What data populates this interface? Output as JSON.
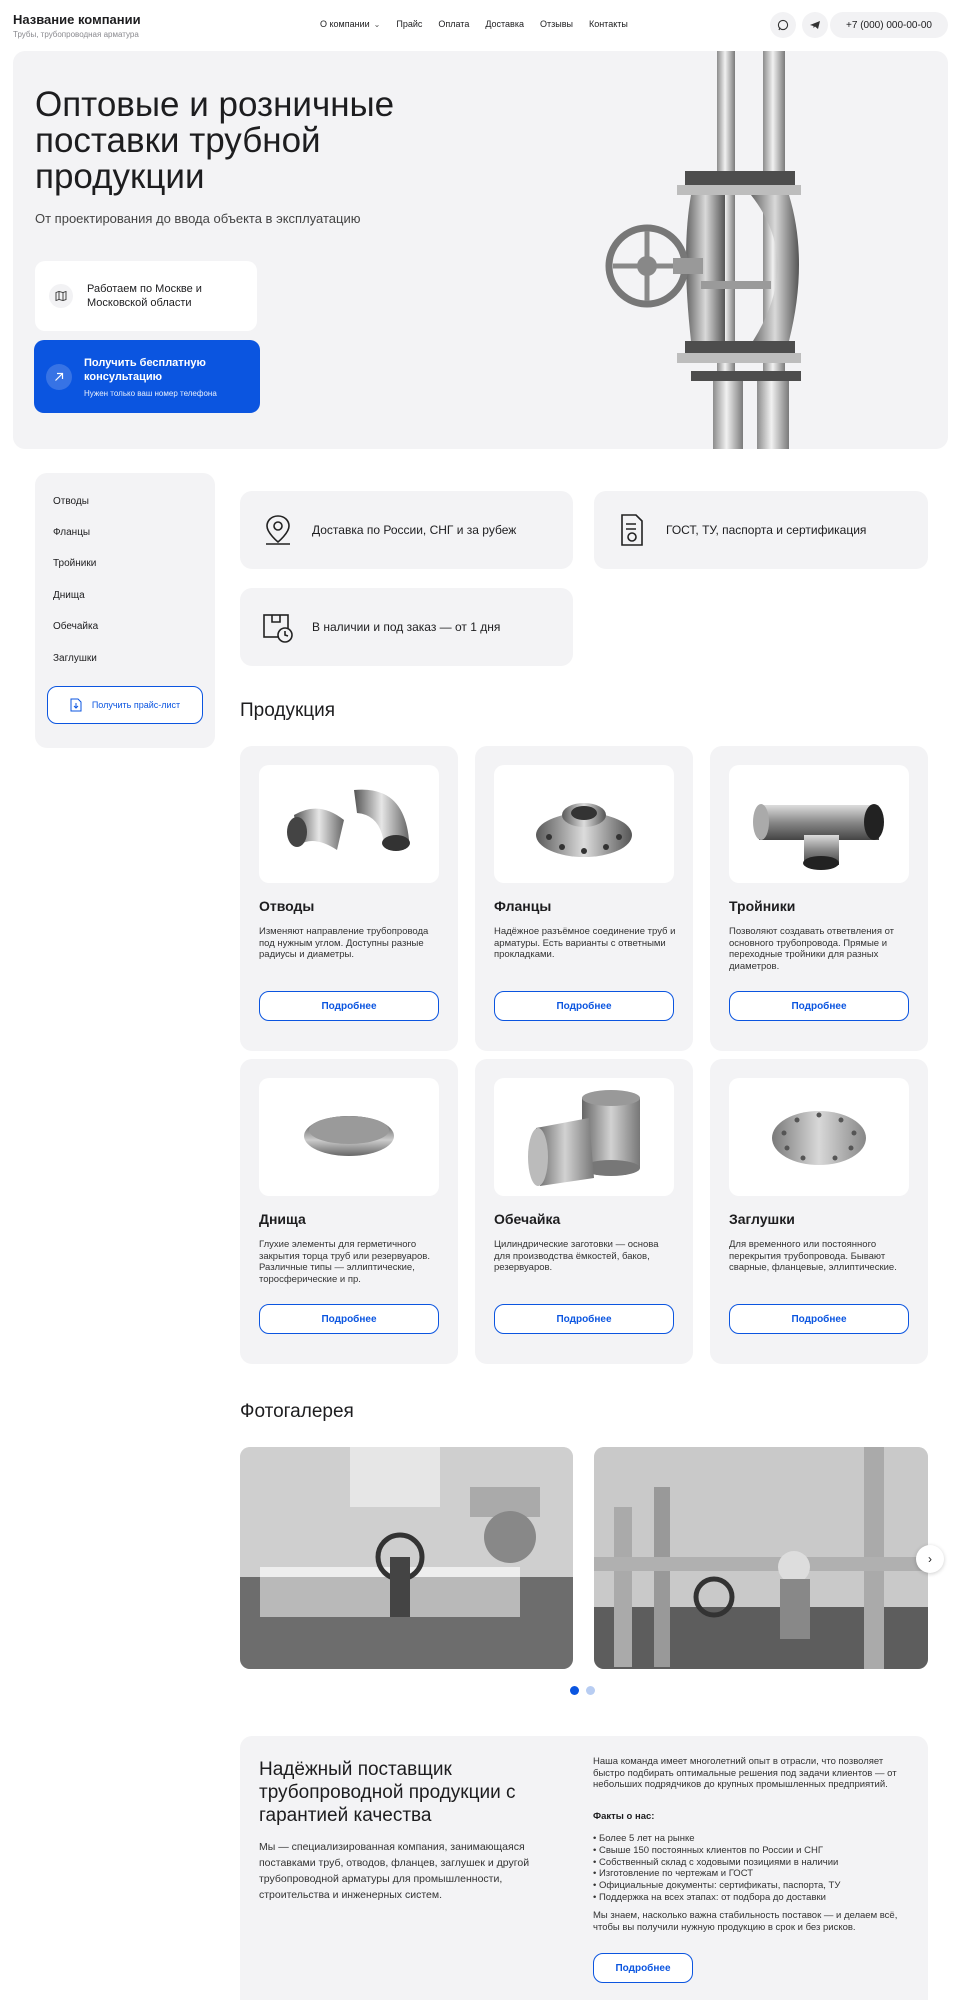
{
  "header": {
    "company": "Название компании",
    "tagline": "Трубы, трубопроводная арматура",
    "nav": [
      "О компании",
      "Прайс",
      "Оплата",
      "Доставка",
      "Отзывы",
      "Контакты"
    ],
    "phone": "+7 (000) 000-00-00"
  },
  "hero": {
    "title": "Оптовые и розничные поставки трубной продукции",
    "lead": "От проектирования до ввода объекта в эксплуатацию",
    "region": "Работаем по Москве и Московской области",
    "cta_title": "Получить бесплатную консультацию",
    "cta_sub": "Нужен только ваш номер телефона"
  },
  "sidebar": {
    "items": [
      "Отводы",
      "Фланцы",
      "Тройники",
      "Днища",
      "Обечайка",
      "Заглушки"
    ],
    "price_button": "Получить прайс-лист"
  },
  "features": [
    "Доставка по России, СНГ и за рубеж",
    "ГОСТ, ТУ, паспорта и сертификация",
    "В наличии и под заказ — от 1 дня"
  ],
  "products": {
    "title": "Продукция",
    "more_label": "Подробнее",
    "items": [
      {
        "name": "Отводы",
        "desc": "Изменяют направление трубопровода под нужным углом. Доступны разные радиусы и диаметры."
      },
      {
        "name": "Фланцы",
        "desc": "Надёжное разъёмное соединение труб и арматуры. Есть варианты с ответными прокладками."
      },
      {
        "name": "Тройники",
        "desc": "Позволяют создавать ответвления от основного трубопровода. Прямые и переходные тройники для разных диаметров."
      },
      {
        "name": "Днища",
        "desc": "Глухие элементы для герметичного закрытия торца труб или резервуаров. Различные типы — эллиптические, торосферические и пр."
      },
      {
        "name": "Обечайка",
        "desc": "Цилиндрические заготовки — основа для производства ёмкостей, баков, резервуаров."
      },
      {
        "name": "Заглушки",
        "desc": "Для временного или постоянного перекрытия трубопровода. Бывают сварные, фланцевые, эллиптические."
      }
    ]
  },
  "gallery": {
    "title": "Фотогалерея",
    "arrow": "›"
  },
  "about": {
    "title": "Надёжный поставщик трубопроводной продукции с гарантией качества",
    "desc": "Мы — специализированная компания, занимающаяся поставками труб, отводов, фланцев, заглушек и другой трубопроводной арматуры для промышленности, строительства и инженерных систем.",
    "intro": "Наша команда имеет многолетний опыт в отрасли, что позволяет быстро подбирать оптимальные решения под задачи клиентов — от небольших подрядчиков до крупных промышленных предприятий.",
    "facts_title": "Факты о нас:",
    "facts": [
      "• Более 5 лет на рынке",
      "• Свыше 150 постоянных клиентов по России и СНГ",
      "• Собственный склад с ходовыми позициями в наличии",
      "• Изготовление по чертежам и ГОСТ",
      "• Официальные документы: сертификаты, паспорта, ТУ",
      "• Поддержка на всех этапах: от подбора до доставки"
    ],
    "outro": "Мы знаем, насколько важна стабильность поставок — и делаем всё, чтобы вы получили нужную продукцию в срок и без рисков.",
    "more_label": "Подробнее"
  },
  "colors": {
    "accent": "#0b55e0",
    "panel": "#f3f3f5"
  }
}
